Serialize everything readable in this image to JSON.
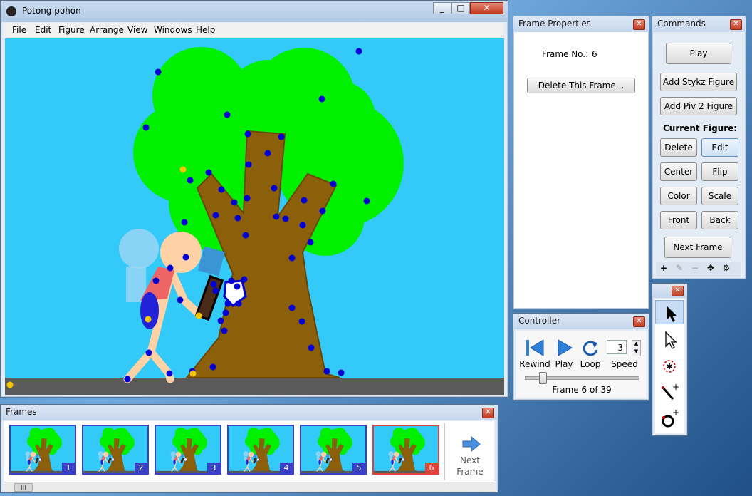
{
  "main_window": {
    "title": "Potong pohon",
    "menu": [
      "File",
      "Edit",
      "Figure",
      "Arrange",
      "View",
      "Windows",
      "Help"
    ]
  },
  "frame_properties": {
    "title": "Frame Properties",
    "frame_no_label": "Frame No.:",
    "frame_no_value": "6",
    "delete_button": "Delete This Frame..."
  },
  "commands": {
    "title": "Commands",
    "play": "Play",
    "add_stykz": "Add Stykz Figure",
    "add_piv": "Add Piv 2 Figure",
    "current_figure_label": "Current Figure:",
    "delete": "Delete",
    "edit": "Edit",
    "center": "Center",
    "flip": "Flip",
    "color": "Color",
    "scale": "Scale",
    "front": "Front",
    "back": "Back",
    "next_frame": "Next Frame"
  },
  "controller": {
    "title": "Controller",
    "rewind": "Rewind",
    "play": "Play",
    "loop": "Loop",
    "speed_label": "Speed",
    "speed_value": "3",
    "status": "Frame 6 of 39",
    "position": 0.13
  },
  "frames_panel": {
    "title": "Frames",
    "frames": [
      "1",
      "2",
      "3",
      "4",
      "5",
      "6"
    ],
    "active_index": 5,
    "next_label_1": "Next",
    "next_label_2": "Frame"
  },
  "colors": {
    "sky": "#33c9f9",
    "ground": "#5a5a5a",
    "tree_green": "#00f000",
    "trunk_brown": "#8c5f0a",
    "joint_blue": "#0000d6",
    "joint_yellow": "#f5c400",
    "active_frame": "#e0433a",
    "frame_border": "#3a41c8"
  }
}
